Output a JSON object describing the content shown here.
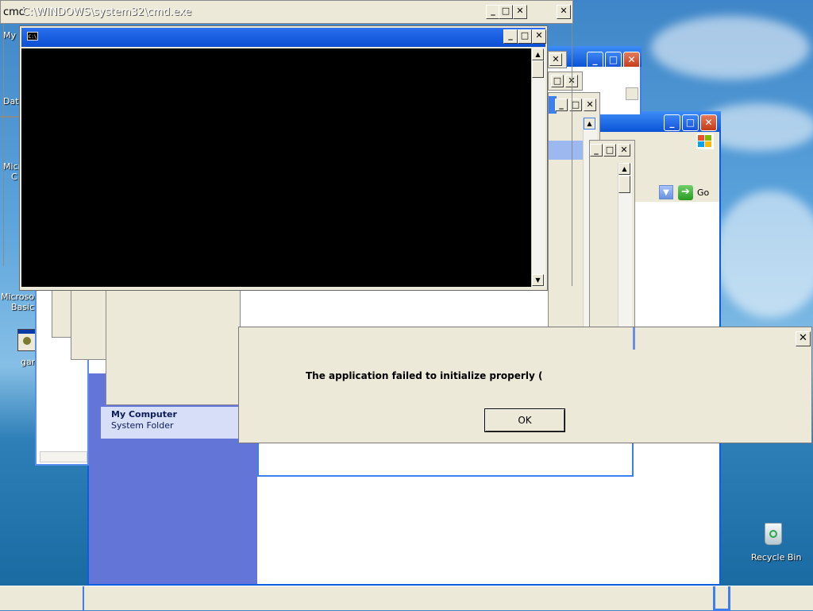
{
  "desktop": {
    "icons": {
      "my_computer_label": "My",
      "data_label": "Data",
      "micro_label": "Micro",
      "micro_label2": "C",
      "ms_basic_label1": "Microsoft",
      "ms_basic_label2": "Basic",
      "game_label": "gam",
      "recycle_bin_label": "Recycle Bin"
    }
  },
  "cmd_window": {
    "title": "C:\\WINDOWS\\system32\\cmd.exe",
    "title_prefix": "cmd",
    "inner_icon_text": "C:\\",
    "min_glyph": "_",
    "max_glyph": "□",
    "close_glyph": "✕"
  },
  "explorer_window": {
    "go_label": "Go",
    "details_title": "My Computer",
    "details_sub": "System Folder"
  },
  "error_dialog": {
    "message": "The application failed to initialize properly (",
    "ok_label": "OK",
    "close_glyph": "✕"
  },
  "colors": {
    "xp_blue": "#0a5fe0",
    "dialog_beige": "#ece9d8",
    "taskbar_beige": "#ece9d8",
    "explorer_side_panel": "#6375d6"
  }
}
